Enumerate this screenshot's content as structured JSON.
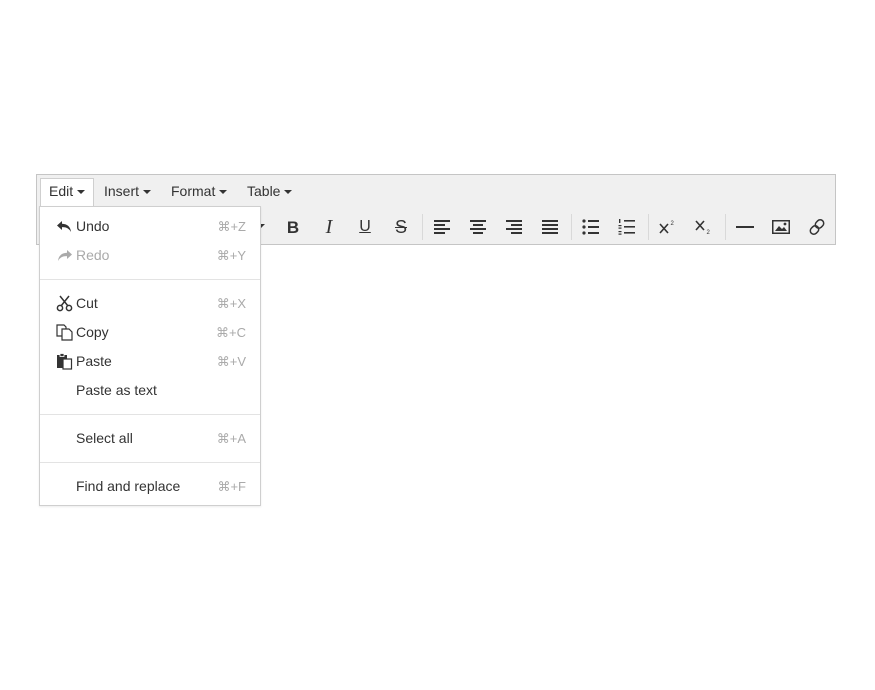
{
  "menubar": {
    "items": [
      {
        "label": "Edit"
      },
      {
        "label": "Insert"
      },
      {
        "label": "Format"
      },
      {
        "label": "Table"
      }
    ]
  },
  "toolbar": {
    "buttons": [
      {
        "icon": "bold-icon",
        "glyph": "B"
      },
      {
        "icon": "italic-icon",
        "glyph": "I"
      },
      {
        "icon": "underline-icon",
        "glyph": "U"
      },
      {
        "icon": "strikethrough-icon",
        "glyph": "S"
      },
      {
        "icon": "align-left-icon"
      },
      {
        "icon": "align-center-icon"
      },
      {
        "icon": "align-right-icon"
      },
      {
        "icon": "align-justify-icon"
      },
      {
        "icon": "bullet-list-icon"
      },
      {
        "icon": "numbered-list-icon"
      },
      {
        "icon": "superscript-icon"
      },
      {
        "icon": "subscript-icon"
      },
      {
        "icon": "horizontal-rule-icon"
      },
      {
        "icon": "image-icon"
      },
      {
        "icon": "link-icon"
      }
    ]
  },
  "edit_menu": {
    "items": [
      {
        "label": "Undo",
        "shortcut": "⌘+Z",
        "icon": "undo-icon",
        "disabled": false
      },
      {
        "label": "Redo",
        "shortcut": "⌘+Y",
        "icon": "redo-icon",
        "disabled": true
      },
      {
        "label": "Cut",
        "shortcut": "⌘+X",
        "icon": "cut-icon",
        "disabled": false
      },
      {
        "label": "Copy",
        "shortcut": "⌘+C",
        "icon": "copy-icon",
        "disabled": false
      },
      {
        "label": "Paste",
        "shortcut": "⌘+V",
        "icon": "paste-icon",
        "disabled": false
      },
      {
        "label": "Paste as text",
        "shortcut": "",
        "icon": "",
        "disabled": false
      },
      {
        "label": "Select all",
        "shortcut": "⌘+A",
        "icon": "",
        "disabled": false
      },
      {
        "label": "Find and replace",
        "shortcut": "⌘+F",
        "icon": "",
        "disabled": false
      }
    ]
  },
  "colors": {
    "toolbar_bg": "#f0f0f0",
    "border": "#c5c5c5",
    "text": "#333333",
    "disabled_text": "#aaaaaa"
  }
}
